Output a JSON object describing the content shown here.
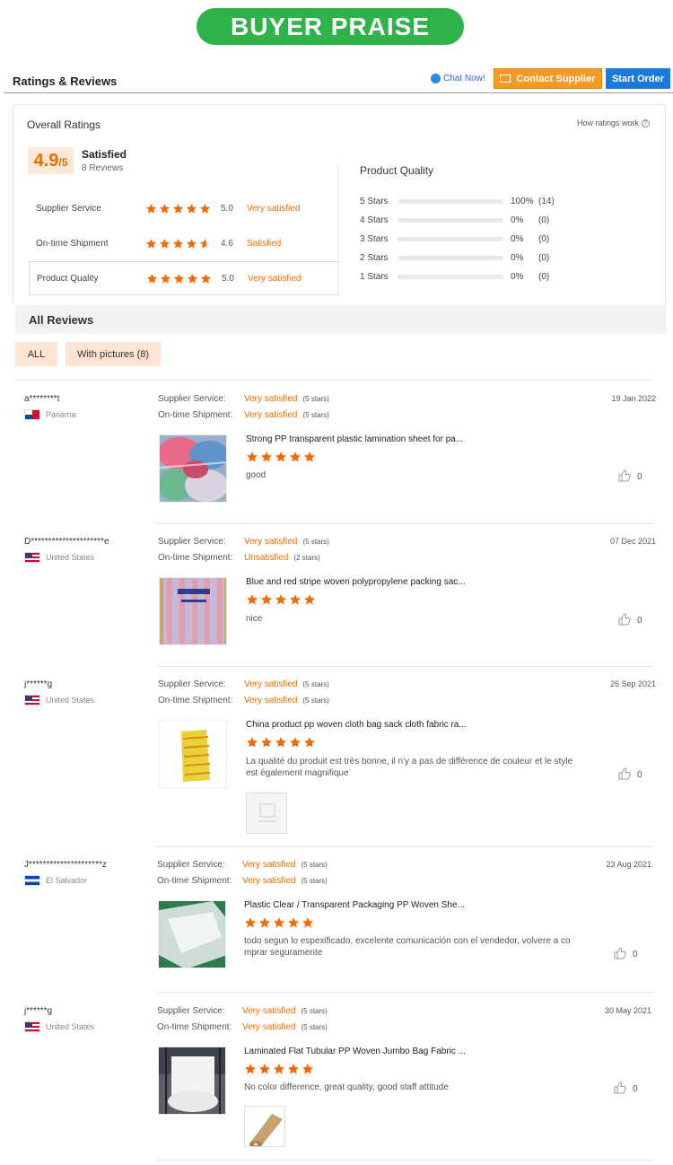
{
  "banner": {
    "title": "BUYER PRAISE"
  },
  "topbar": {
    "title": "Ratings & Reviews",
    "chat": "Chat Now!",
    "contact": "Contact Supplier",
    "start": "Start Order"
  },
  "overall": {
    "label": "Overall Ratings",
    "how": "How ratings work",
    "score": "4.9",
    "score_max": "/5",
    "satisfaction": "Satisfied",
    "count": "8 Reviews",
    "rows": [
      {
        "label": "Supplier Service",
        "stars": 5,
        "score": "5.0",
        "text": "Very satisfied"
      },
      {
        "label": "On-time Shipment",
        "stars": 4.6,
        "score": "4.6",
        "text": "Satisfied"
      },
      {
        "label": "Product Quality",
        "stars": 5,
        "score": "5.0",
        "text": "Very satisfied"
      }
    ]
  },
  "product_quality": {
    "title": "Product Quality",
    "bars": [
      {
        "label": "5 Stars",
        "fraction": 1.0,
        "pct": "100%",
        "count": "(14)"
      },
      {
        "label": "4 Stars",
        "fraction": 0,
        "pct": "0%",
        "count": "(0)"
      },
      {
        "label": "3 Stars",
        "fraction": 0,
        "pct": "0%",
        "count": "(0)"
      },
      {
        "label": "2 Stars",
        "fraction": 0,
        "pct": "0%",
        "count": "(0)"
      },
      {
        "label": "1 Stars",
        "fraction": 0,
        "pct": "0%",
        "count": "(0)"
      }
    ]
  },
  "all_reviews": {
    "title": "All Reviews",
    "filters": [
      "ALL",
      "With pictures (8)"
    ]
  },
  "labels": {
    "service": "Supplier Service:",
    "shipment": "On-time Shipment:"
  },
  "reviews": [
    {
      "user": "a********t",
      "country": "Panama",
      "flag": "pa",
      "date": "19 Jan 2022",
      "service": "Very satisfied",
      "service_stars": "(5 stars)",
      "shipment": "Very satisfied",
      "shipment_stars": "(5 stars)",
      "product": "Strong PP transparent plastic lamination sheet for pa...",
      "stars": 5,
      "text": "good",
      "likes": "0"
    },
    {
      "user": "D*********************e",
      "country": "United States",
      "flag": "us",
      "date": "07 Dec 2021",
      "service": "Very satisfied",
      "service_stars": "(5 stars)",
      "shipment": "Unsatisfied",
      "shipment_stars": "(2 stars)",
      "product": "Blue and red stripe woven polypropylene packing sac...",
      "stars": 5,
      "text": "nice",
      "likes": "0"
    },
    {
      "user": "j******g",
      "country": "United States",
      "flag": "us",
      "date": "25 Sep 2021",
      "service": "Very satisfied",
      "service_stars": "(5 stars)",
      "shipment": "Very satisfied",
      "shipment_stars": "(5 stars)",
      "product": "China product pp woven cloth bag sack cloth fabric ra...",
      "stars": 5,
      "text": "La qualité du produit est très bonne, il n'y a pas de différence de couleur et le style est également magnifique",
      "likes": "0"
    },
    {
      "user": "J*********************z",
      "country": "El Salvador",
      "flag": "sv",
      "date": "23 Aug 2021",
      "service": "Very satisfied",
      "service_stars": "(5 stars)",
      "shipment": "Very satisfied",
      "shipment_stars": "(5 stars)",
      "product": "Plastic Clear / Transparent Packaging PP Woven She...",
      "stars": 5,
      "text": "todo segun lo espexificado, excelente comunicación con el vendedor, volvere a co mprar seguramente",
      "likes": "0"
    },
    {
      "user": "j******g",
      "country": "United States",
      "flag": "us",
      "date": "30 May 2021",
      "service": "Very satisfied",
      "service_stars": "(5 stars)",
      "shipment": "Very satisfied",
      "shipment_stars": "(5 stars)",
      "product": "Laminated Flat Tubular PP Woven Jumbo Bag Fabric ...",
      "stars": 5,
      "text": "No color difference, great quality, good staff attitude",
      "likes": "0"
    }
  ],
  "colors": {
    "accent": "#f06c00",
    "banner": "#2db34a",
    "contact": "#f59a23",
    "start": "#1a7ad9"
  }
}
